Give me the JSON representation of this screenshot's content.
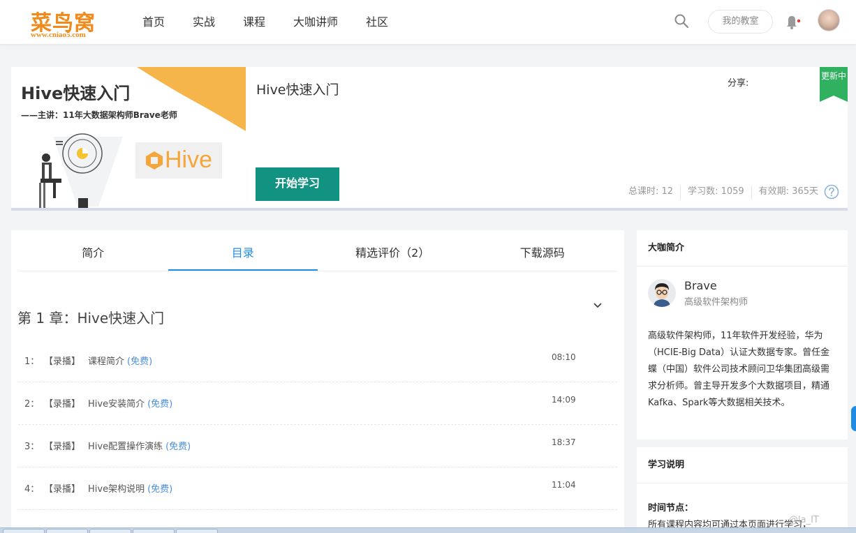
{
  "header": {
    "logo_main": "菜鸟窝",
    "logo_sub": "www.cniao5.com",
    "nav": [
      "首页",
      "实战",
      "课程",
      "大咖讲师",
      "社区"
    ],
    "my_class": "我的教室"
  },
  "course": {
    "cover_title": "Hive快速入门",
    "cover_subtitle": "——主讲：11年大数据架构师Brave老师",
    "cover_logo_text": "Hive",
    "title": "Hive快速入门",
    "share_label": "分享:",
    "ribbon": "更新中",
    "start_button": "开始学习",
    "stats": {
      "lessons": "总课时: 12",
      "learners": "学习数: 1059",
      "validity": "有效期: 365天"
    }
  },
  "tabs": [
    "简介",
    "目录",
    "精选评价（2）",
    "下载源码"
  ],
  "active_tab": "目录",
  "chapter": {
    "title": "第 1 章：Hive快速入门",
    "lessons": [
      {
        "num": "1：",
        "type": "【录播】",
        "name": "课程简介",
        "free": "(免费)",
        "time": "08:10"
      },
      {
        "num": "2：",
        "type": "【录播】",
        "name": "Hive安装简介",
        "free": "(免费)",
        "time": "14:09"
      },
      {
        "num": "3：",
        "type": "【录播】",
        "name": "Hive配置操作演练",
        "free": "(免费)",
        "time": "18:37"
      },
      {
        "num": "4：",
        "type": "【录播】",
        "name": "Hive架构说明",
        "free": "(免费)",
        "time": "11:04"
      }
    ]
  },
  "sidebar": {
    "teacher_heading": "大咖简介",
    "teacher_name": "Brave",
    "teacher_title": "高级软件架构师",
    "teacher_bio": "高级软件架构师，11年软件开发经验，华为（HCIE-Big Data）认证大数据专家。曾任金蝶（中国）软件公司技术顾问卫华集团高级需求分析师。曾主导开发多个大数据项目，精通Kafka、Spark等大数据相关技术。",
    "study_heading": "学习说明",
    "study_label": "时间节点：",
    "study_text": "所有课程内容均可通过本页面进行学习，"
  },
  "watermark": "@la_IT",
  "colors": {
    "brand_orange": "#f08a1a",
    "primary_green": "#129382",
    "tab_blue": "#1e8ce4",
    "ribbon_green": "#2fb15f"
  }
}
